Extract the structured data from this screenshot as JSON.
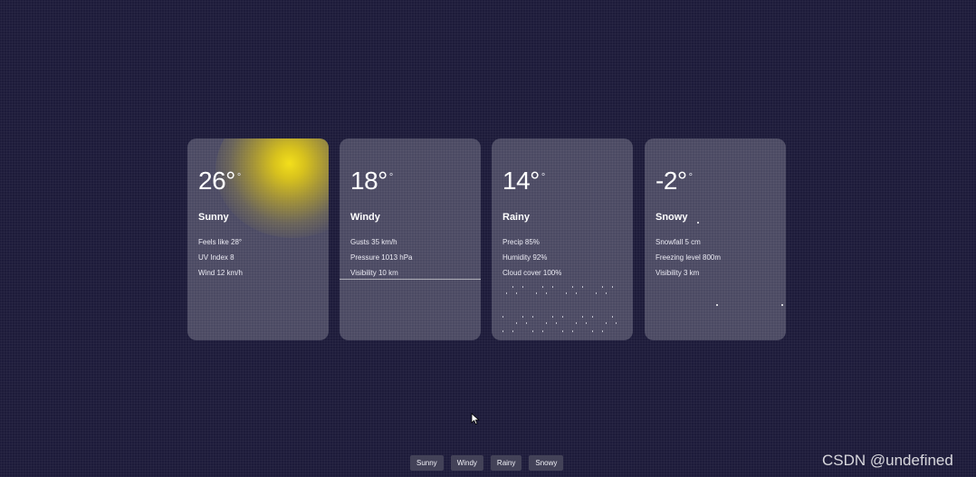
{
  "cards": [
    {
      "temp": "26°",
      "unit": "°",
      "condition": "Sunny",
      "details": [
        "Feels like 28°",
        "UV Index 8",
        "Wind 12 km/h"
      ]
    },
    {
      "temp": "18°",
      "unit": "°",
      "condition": "Windy",
      "details": [
        "Gusts 35 km/h",
        "Pressure 1013 hPa",
        "Visibility 10 km"
      ]
    },
    {
      "temp": "14°",
      "unit": "°",
      "condition": "Rainy",
      "details": [
        "Precip 85%",
        "Humidity 92%",
        "Cloud cover 100%"
      ]
    },
    {
      "temp": "-2°",
      "unit": "°",
      "condition": "Snowy",
      "details": [
        "Snowfall 5 cm",
        "Freezing level 800m",
        "Visibility 3 km"
      ]
    }
  ],
  "switcher": [
    "Sunny",
    "Windy",
    "Rainy",
    "Snowy"
  ],
  "watermark": "CSDN @undefined",
  "icons": {
    "cursor": "arrow-cursor-icon",
    "sun": "sun-glow-icon",
    "wind": "wind-line-icon",
    "rain": "raindrop-icon",
    "snow": "snowflake-icon"
  },
  "colors": {
    "background": "#1d1b3a",
    "card": "#4b4a63",
    "sun": "#f3df1b",
    "button": "#434258"
  }
}
